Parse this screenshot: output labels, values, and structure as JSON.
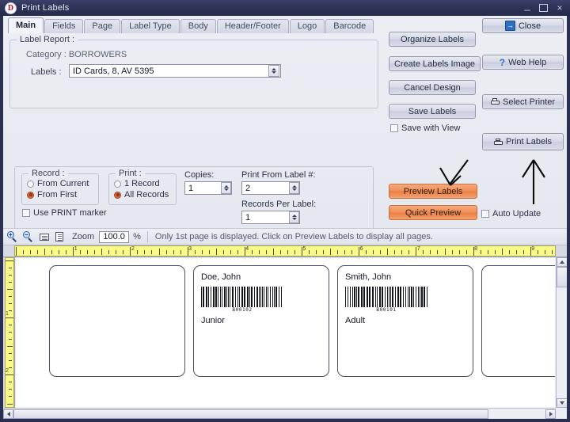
{
  "window": {
    "title": "Print Labels",
    "app_initial": "D",
    "controls": {
      "minimize": "_",
      "maximize": "maximize-icon",
      "close": "×"
    }
  },
  "tabs": [
    {
      "label": "Main",
      "active": true
    },
    {
      "label": "Fields",
      "active": false
    },
    {
      "label": "Page",
      "active": false
    },
    {
      "label": "Label Type",
      "active": false
    },
    {
      "label": "Body",
      "active": false
    },
    {
      "label": "Header/Footer",
      "active": false
    },
    {
      "label": "Logo",
      "active": false
    },
    {
      "label": "Barcode",
      "active": false
    }
  ],
  "label_report": {
    "legend": "Label Report :",
    "category_label": "Category :",
    "category_value": "BORROWERS",
    "labels_label": "Labels :",
    "labels_value": "ID Cards, 8, AV 5395"
  },
  "record_group": {
    "legend": "Record :",
    "options": [
      {
        "label": "From Current",
        "selected": false
      },
      {
        "label": "From First",
        "selected": true
      }
    ]
  },
  "print_group": {
    "legend": "Print :",
    "options": [
      {
        "label": "1 Record",
        "selected": false
      },
      {
        "label": "All Records",
        "selected": true
      }
    ]
  },
  "print_marker": {
    "label": "Use PRINT marker",
    "checked": false
  },
  "fields": {
    "copies_label": "Copies:",
    "copies_value": "1",
    "print_from_label": "Print From Label #:",
    "print_from_value": "2",
    "records_per_label": "Records Per Label:",
    "records_per_value": "1"
  },
  "buttons": {
    "organize_labels": "Organize Labels",
    "create_labels_image": "Create Labels Image",
    "cancel_design": "Cancel Design",
    "save_labels": "Save Labels",
    "close": "Close",
    "web_help": "Web Help",
    "select_printer": "Select Printer",
    "print_labels": "Print Labels",
    "preview_labels": "Preview Labels",
    "quick_preview": "Quick Preview"
  },
  "checkboxes": {
    "save_with_view": {
      "label": "Save with View",
      "checked": false
    },
    "auto_update": {
      "label": "Auto Update",
      "checked": false
    }
  },
  "toolbar": {
    "zoom_label": "Zoom",
    "zoom_value": "100.0",
    "percent": "%",
    "status": "Only 1st page is displayed. Click on Preview Labels to display all pages.",
    "icons": [
      "zoom-in-icon",
      "zoom-out-icon",
      "fit-page-icon",
      "whole-page-icon"
    ]
  },
  "rulers": {
    "horizontal_ticks": [
      "1",
      "2",
      "3",
      "4",
      "5",
      "6",
      "7",
      "8",
      "9"
    ],
    "vertical_ticks": [
      "1",
      "2"
    ],
    "unit": "inch"
  },
  "preview_cards": [
    {
      "name": "",
      "barcode_text": "",
      "role": "",
      "empty": true
    },
    {
      "name": "Doe, John",
      "barcode_text": "B00102",
      "role": "Junior",
      "empty": false
    },
    {
      "name": "Smith, John",
      "barcode_text": "B00101",
      "role": "Adult",
      "empty": false
    },
    {
      "name": "",
      "barcode_text": "",
      "role": "",
      "empty": true
    }
  ],
  "colors": {
    "titlebar": "#2e3458",
    "accent_orange": "#ef8f56",
    "radio_selected": "#d2663a",
    "ruler_yellow": "#fbfa86",
    "panel": "#e9ebf2",
    "icon_blue": "#2f6fbf"
  }
}
